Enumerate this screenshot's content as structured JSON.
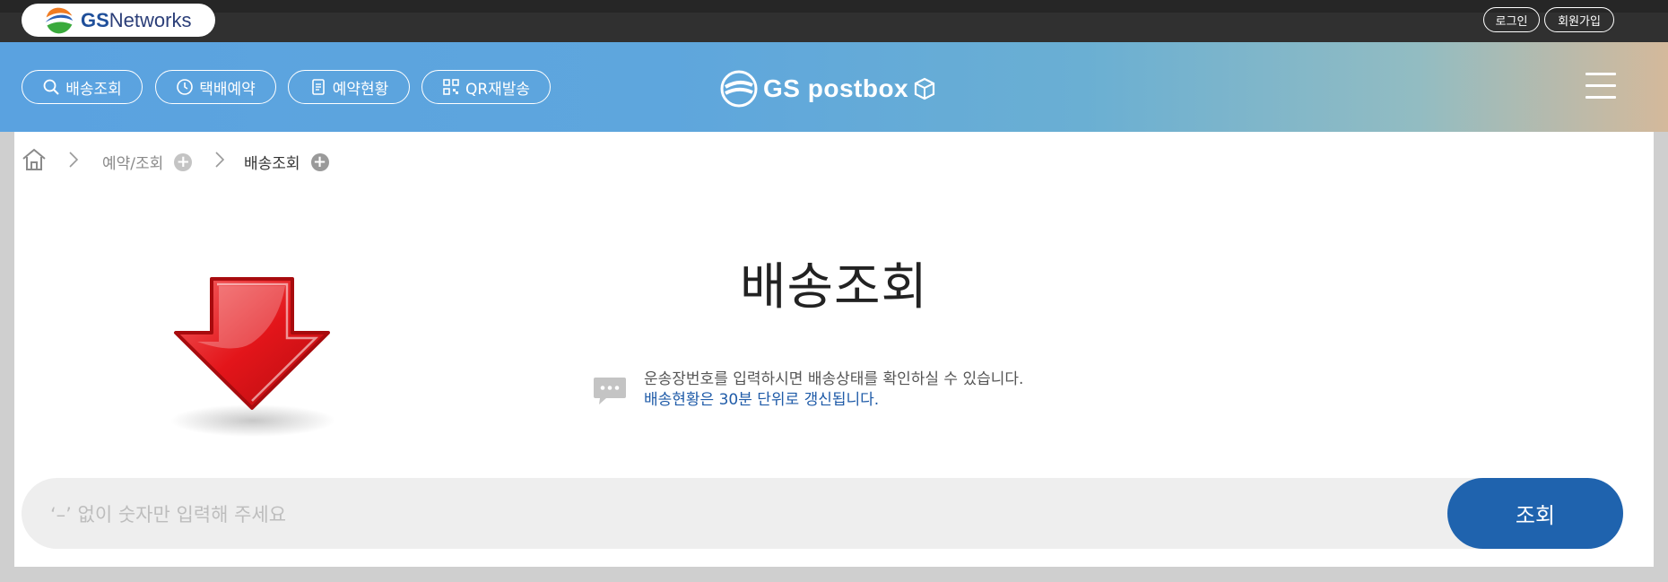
{
  "topbar": {
    "logo_gs": "GS",
    "logo_networks": "Networks",
    "login_label": "로그인",
    "signup_label": "회원가입"
  },
  "nav": {
    "items": [
      {
        "label": "배송조회",
        "icon": "search-icon"
      },
      {
        "label": "택배예약",
        "icon": "clock-icon"
      },
      {
        "label": "예약현황",
        "icon": "document-icon"
      },
      {
        "label": "QR재발송",
        "icon": "qr-code-icon"
      }
    ],
    "brand": "GS postbox",
    "menu_icon": "hamburger-menu-icon"
  },
  "breadcrumb": {
    "items": [
      "예약/조회",
      "배송조회"
    ]
  },
  "main": {
    "title": "배송조회",
    "info_line1": "운송장번호를 입력하시면 배송상태를 확인하실 수 있습니다.",
    "info_line2": "배송현황은 30분 단위로 갱신됩니다."
  },
  "search": {
    "placeholder": "‘–’ 없이 숫자만 입력해 주세요",
    "button_label": "조회"
  },
  "colors": {
    "accent": "#1f63ae",
    "info_blue": "#1f5ba8",
    "arrow_red": "#e3151a"
  }
}
